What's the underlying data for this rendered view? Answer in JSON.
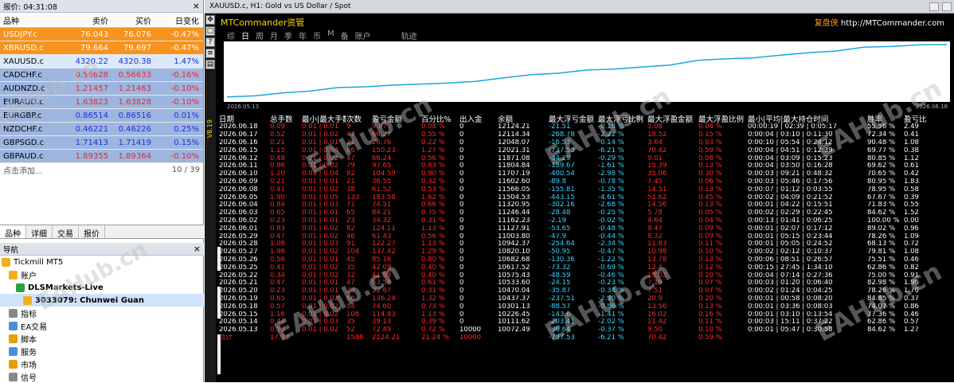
{
  "market_watch": {
    "header": "报价: 04:31:08",
    "columns": [
      "品种",
      "卖价",
      "买价",
      "日变化"
    ],
    "rows": [
      {
        "symbol": "USDJPY.c",
        "bid": "76.043",
        "ask": "76.076",
        "chg": "-0.47%",
        "style": "orange"
      },
      {
        "symbol": "XBRUSD.c",
        "bid": "79.664",
        "ask": "79.697",
        "chg": "-0.47%",
        "style": "orange"
      },
      {
        "symbol": "XAUUSD.c",
        "bid": "4320.22",
        "ask": "4320.38",
        "chg": "1.47%",
        "style": "light"
      },
      {
        "symbol": "CADCHF.c",
        "bid": "0.56628",
        "ask": "0.56633",
        "chg": "-0.16%",
        "style": "blue"
      },
      {
        "symbol": "AUDNZD.c",
        "bid": "1.21457",
        "ask": "1.21463",
        "chg": "-0.10%",
        "style": "blue"
      },
      {
        "symbol": "EURAUD.c",
        "bid": "1.63823",
        "ask": "1.63828",
        "chg": "-0.10%",
        "style": "blue"
      },
      {
        "symbol": "EURGBP.c",
        "bid": "0.86514",
        "ask": "0.86516",
        "chg": "0.01%",
        "style": "blue"
      },
      {
        "symbol": "NZDCHF.c",
        "bid": "0.46221",
        "ask": "0.46226",
        "chg": "0.25%",
        "style": "blue"
      },
      {
        "symbol": "GBPSGD.c",
        "bid": "1.71413",
        "ask": "1.71419",
        "chg": "0.15%",
        "style": "blue"
      },
      {
        "symbol": "GBPAUD.c",
        "bid": "1.89355",
        "ask": "1.89364",
        "chg": "-0.10%",
        "style": "blue"
      }
    ],
    "add_label": "点击添加...",
    "count": "10 / 39"
  },
  "tabs": [
    "品种",
    "详细",
    "交易",
    "报价"
  ],
  "navigator": {
    "header": "导航",
    "items": [
      {
        "label": "Tickmill MT5",
        "indent": 0,
        "bold": false
      },
      {
        "label": "账户",
        "indent": 1,
        "bold": false
      },
      {
        "label": "DLSMarkets-Live",
        "indent": 2,
        "bold": true
      },
      {
        "label": "3033079: Chunwei Guan",
        "indent": 3,
        "bold": true
      },
      {
        "label": "指标",
        "indent": 1,
        "bold": false
      },
      {
        "label": "EA交易",
        "indent": 1,
        "bold": false
      },
      {
        "label": "脚本",
        "indent": 1,
        "bold": false
      },
      {
        "label": "服务",
        "indent": 1,
        "bold": false
      },
      {
        "label": "市场",
        "indent": 1,
        "bold": false
      },
      {
        "label": "信号",
        "indent": 1,
        "bold": false
      }
    ]
  },
  "chart": {
    "window_title": "XAUUSD.c, H1:  Gold vs US Dollar / Spot",
    "indicator_title": "MTCommander资管",
    "brand_cn": "复盘侠",
    "brand_url": "http://MTCommander.com",
    "periods": [
      "综",
      "日",
      "周",
      "月",
      "季",
      "年",
      "币",
      "M",
      "备",
      "账户",
      "轨迹"
    ],
    "selected_period": "日",
    "date_left": "2026.05.13",
    "date_right": "2026.06.18",
    "vertical_label": "V8.19",
    "watermark": "EAHub.cn",
    "columns": [
      "日期",
      "总手数",
      "最小|最大手数",
      "次数",
      "盈亏金额",
      "百分比%",
      "出入金",
      "余额",
      "最大浮亏金额",
      "最大浮亏比例",
      "最大浮盈金额",
      "最大浮盈比例",
      "最小|平均|最大持仓时间",
      "胜率",
      "盈亏比"
    ],
    "rows": [
      [
        "2026.06.18",
        "0.09",
        "0.01 | 0.01",
        "9",
        "9.87",
        "0.08 %",
        "0",
        "12124.21",
        "-21.51",
        "-0.18 %",
        "5.08",
        "0.04 %",
        "00:00:19 | 02:39 | 0:05:17",
        "55.56 %",
        "2.49"
      ],
      [
        "2026.06.17",
        "0.52",
        "0.01 | 0.02",
        "47",
        "66.27",
        "0.55 %",
        "0",
        "12114.34",
        "-268.78",
        "-2.22 %",
        "18.52",
        "0.15 %",
        "0:00:04 | 03:10 | 0:11:30",
        "72.34 %",
        "0.41"
      ],
      [
        "2026.06.16",
        "0.21",
        "0.01 | 0.01",
        "21",
        "26.76",
        "0.22 %",
        "0",
        "12048.07",
        "-16.53",
        "-0.14 %",
        "3.64",
        "0.03 %",
        "0:00:10 | 05:54 | 0:24:12",
        "90.48 %",
        "1.08"
      ],
      [
        "2026.06.15",
        "1.15",
        "0.01 | 0.04",
        "86",
        "150.23",
        "1.27 %",
        "0",
        "12021.31",
        "-737.53",
        "-6.21 %",
        "70.42",
        "0.59 %",
        "0:00:04 | 04:51 | 0:12:39",
        "69.77 %",
        "0.38"
      ],
      [
        "2026.06.12",
        "0.48",
        "0.01 | 0.02",
        "47",
        "66.24",
        "0.56 %",
        "0",
        "11871.08",
        "-34.29",
        "-0.29 %",
        "9.01",
        "0.08 %",
        "0:00:04 | 03:09 | 0:15:23",
        "80.85 %",
        "1.12"
      ],
      [
        "2026.06.11",
        "0.86",
        "0.01 | 0.02",
        "79",
        "97.65",
        "0.83 %",
        "0",
        "11804.84",
        "-189.67",
        "-1.61 %",
        "15.39",
        "0.13 %",
        "0:00:04 | 03:50 | 0:16:28",
        "69.62 %",
        "0.61"
      ],
      [
        "2026.06.10",
        "1.20",
        "0.01 | 0.04",
        "92",
        "104.59",
        "0.90 %",
        "0",
        "11707.19",
        "-400.54",
        "-2.98 %",
        "35.06",
        "0.30 %",
        "0:00:03 | 09:21 | 0:48:32",
        "70.65 %",
        "0.42"
      ],
      [
        "2026.06.09",
        "0.21",
        "0.01 | 0.01",
        "21",
        "36.55",
        "0.32 %",
        "0",
        "11602.60",
        "-89.8",
        "-0.78 %",
        "7.45",
        "0.06 %",
        "0:00:03 | 05:46 | 0:17:56",
        "80.95 %",
        "1.83"
      ],
      [
        "2026.06.08",
        "0.41",
        "0.01 | 0.02",
        "38",
        "61.52",
        "0.53 %",
        "0",
        "11566.05",
        "-155.81",
        "-1.35 %",
        "14.51",
        "0.13 %",
        "0:00:07 | 01:12 | 0:03:55",
        "78.95 %",
        "0.58"
      ],
      [
        "2026.06.05",
        "1.90",
        "0.01 | 0.05",
        "133",
        "183.58",
        "1.62 %",
        "0",
        "11504.53",
        "-443.15",
        "-4.61 %",
        "51.62",
        "0.45 %",
        "0:00:02 | 04:09 | 0:21:52",
        "67.67 %",
        "0.39"
      ],
      [
        "2026.06.04",
        "0.84",
        "0.01 | 0.03",
        "71",
        "74.51",
        "0.66 %",
        "0",
        "11320.95",
        "-302.16",
        "-2.68 %",
        "14.56",
        "0.13 %",
        "0:00:01 | 04:22 | 0:15:51",
        "71.83 %",
        "0.55"
      ],
      [
        "2026.06.03",
        "0.65",
        "0.01 | 0.01",
        "65",
        "84.21",
        "0.75 %",
        "0",
        "11246.44",
        "-28.48",
        "-0.25 %",
        "5.78",
        "0.05 %",
        "0:00:02 | 02:29 | 0:22:45",
        "84.62 %",
        "1.52"
      ],
      [
        "2026.06.02",
        "0.23",
        "0.01 | 0.01",
        "23",
        "34.32",
        "0.31 %",
        "0",
        "11162.23",
        "-2.19",
        "-0.02 %",
        "4.64",
        "0.04 %",
        "0:00:13 | 01:41 | 0:06:25",
        "100.00 %",
        "0.00"
      ],
      [
        "2026.06.01",
        "0.83",
        "0.01 | 0.02",
        "82",
        "124.11",
        "1.13 %",
        "0",
        "11127.91",
        "-53.65",
        "-0.48 %",
        "9.47",
        "0.09 %",
        "0:00:01 | 02:07 | 0:17:12",
        "89.02 %",
        "0.96"
      ],
      [
        "2026.05.29",
        "0.47",
        "0.01 | 0.02",
        "46",
        "61.43",
        "0.56 %",
        "0",
        "11003.80",
        "-47.9",
        "-0.44 %",
        "8.32",
        "0.09 %",
        "0:00:01 | 05:15 | 0:23:44",
        "78.26 %",
        "1.09"
      ],
      [
        "2026.05.28",
        "1.08",
        "0.01 | 0.03",
        "91",
        "122.27",
        "1.13 %",
        "0",
        "10942.37",
        "-254.64",
        "-2.34 %",
        "11.83",
        "0.11 %",
        "0:00:01 | 05:05 | 0:24:52",
        "68.13 %",
        "0.72"
      ],
      [
        "2026.05.27",
        "1.98",
        "0.01 | 0.02",
        "104",
        "137.42",
        "1.29 %",
        "0",
        "10820.10",
        "-50.95",
        "-0.47 %",
        "10.98",
        "0.10 %",
        "0:00:02 | 02:12 | 0:10:37",
        "79.81 %",
        "1.08"
      ],
      [
        "2026.05.26",
        "0.56",
        "0.01 | 0.01",
        "45",
        "85.16",
        "0.80 %",
        "0",
        "10682.68",
        "-130.36",
        "-1.22 %",
        "13.78",
        "0.13 %",
        "0:00:06 | 08:51 | 0:26:57",
        "75.51 %",
        "0.46"
      ],
      [
        "2026.05.25",
        "0.41",
        "0.01 | 0.02",
        "35",
        "42.09",
        "0.40 %",
        "0",
        "10617.52",
        "-73.32",
        "-0.69 %",
        "12.4",
        "0.12 %",
        "0:00:15 | 27:45 | 1:34:10",
        "62.86 %",
        "0.82"
      ],
      [
        "2026.05.22",
        "0.34",
        "0.01 | 0.02",
        "32",
        "41.83",
        "0.40 %",
        "0",
        "10575.43",
        "-48.59",
        "-0.46 %",
        "10.03",
        "0.10 %",
        "0:00:04 | 07:14 | 0:27:36",
        "75.00 %",
        "0.91"
      ],
      [
        "2026.05.21",
        "0.47",
        "0.01 | 0.01",
        "47",
        "63.58",
        "0.61 %",
        "0",
        "10533.60",
        "-24.15",
        "-0.23 %",
        "7.19",
        "0.07 %",
        "0:00:03 | 01:20 | 0:06:40",
        "82.98 %",
        "1.96"
      ],
      [
        "2026.05.20",
        "0.23",
        "0.01 | 0.01",
        "23",
        "32.67",
        "0.31 %",
        "0",
        "10470.04",
        "-35.87",
        "-0.34 %",
        "7.51",
        "0.07 %",
        "0:00:02 | 01:24 | 0:04:25",
        "78.26 %",
        "1.70"
      ],
      [
        "2026.05.19",
        "0.65",
        "0.01 | 0.02",
        "66",
        "136.24",
        "1.32 %",
        "0",
        "10437.37",
        "-237.51",
        "-2.30 %",
        "20.9",
        "0.20 %",
        "0:00:01 | 00:58 | 0:08:20",
        "84.85 %",
        "0.37"
      ],
      [
        "2026.05.18",
        "0.57",
        "0.01 | 0.02",
        "54",
        "74.60",
        "0.73 %",
        "0",
        "10301.13",
        "-88.57",
        "-0.86 %",
        "13.56",
        "0.13 %",
        "0:00:01 | 03:36 | 0:08:03",
        "74.07 %",
        "0.86"
      ],
      [
        "2026.05.15",
        "1.16",
        "0.01 | 0.02",
        "106",
        "114.83",
        "1.13 %",
        "0",
        "10226.45",
        "-143.6",
        "-1.41 %",
        "16.02",
        "0.16 %",
        "0:00:01 | 03:10 | 0:13:54",
        "77.36 %",
        "0.46"
      ],
      [
        "2026.05.14",
        "0.44",
        "0.01 | 0.03",
        "35",
        "39.13",
        "0.39 %",
        "0",
        "10111.62",
        "-203.41",
        "-2.02 %",
        "11.42",
        "0.11 %",
        "0:00:03 | 15:11 | 0:37:22",
        "62.86 %",
        "0.57"
      ],
      [
        "2026.05.13",
        "0.53",
        "0.01 | 0.02",
        "52",
        "72.49",
        "0.72 %",
        "10000",
        "10072.49",
        "-36.64",
        "-0.37 %",
        "9.50",
        "0.10 %",
        "0:00:01 | 05:47 | 0:30:58",
        "84.62 %",
        "1.27"
      ]
    ],
    "summary": [
      "合计",
      "17.93",
      "",
      "1586",
      "2124.21",
      "21.24 %",
      "10000",
      "",
      "-737.53",
      "-6.21 %",
      "70.42",
      "0.59 %",
      "",
      "",
      ""
    ],
    "colors": {
      "background": "#000000",
      "header": "#ffffff",
      "positive": "#ff2a2a",
      "neutral": "#ffffff",
      "negative": "#37d7ff",
      "title": "#ffd700",
      "equity_line": "#1ca6df"
    }
  }
}
